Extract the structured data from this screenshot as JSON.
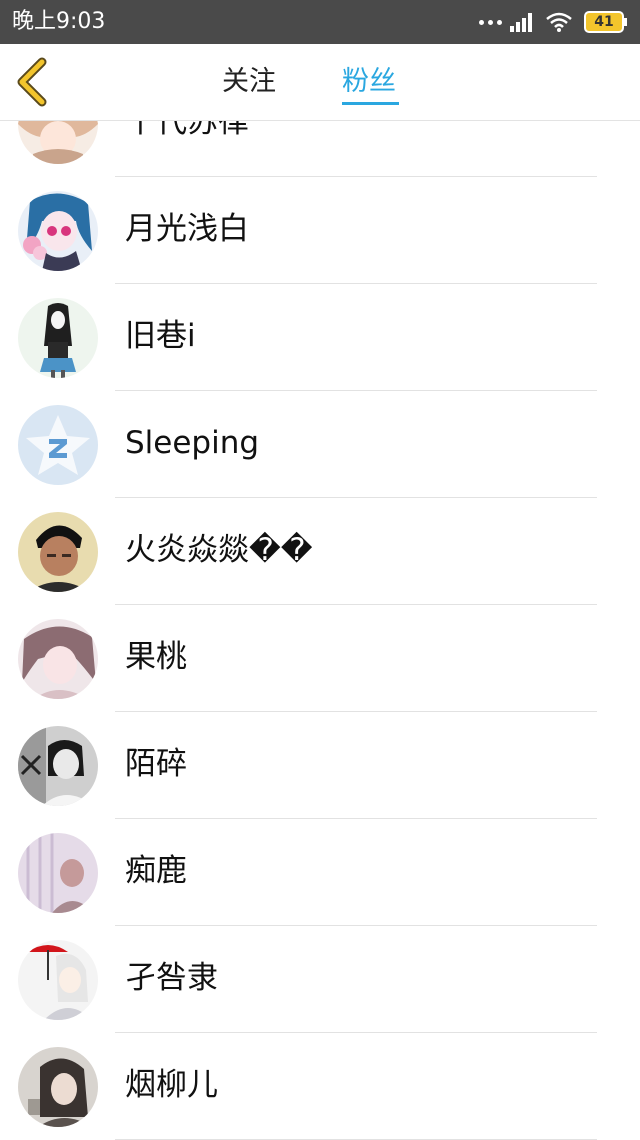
{
  "status_bar": {
    "time": "晚上9:03",
    "battery": "41"
  },
  "nav": {
    "tabs": [
      {
        "label": "关注"
      },
      {
        "label": "粉丝"
      }
    ],
    "accent_color": "#2aa7e0"
  },
  "fans": [
    {
      "name": "千代苏律",
      "avatar": "avatar-pink-hair"
    },
    {
      "name": "月光浅白",
      "avatar": "avatar-anime-girl"
    },
    {
      "name": "旧巷i",
      "avatar": "avatar-sketch-girl"
    },
    {
      "name": "Sleeping",
      "avatar": "avatar-default-qzone"
    },
    {
      "name": "火炎焱燚��",
      "avatar": "avatar-boy-photo"
    },
    {
      "name": "果桃",
      "avatar": "avatar-girl-photo"
    },
    {
      "name": "陌碎",
      "avatar": "avatar-bw-photo"
    },
    {
      "name": "痴鹿",
      "avatar": "avatar-pale-photo"
    },
    {
      "name": "孑咎隶",
      "avatar": "avatar-white-hair-umbrella"
    },
    {
      "name": "烟柳儿",
      "avatar": "avatar-gray-girl"
    }
  ]
}
